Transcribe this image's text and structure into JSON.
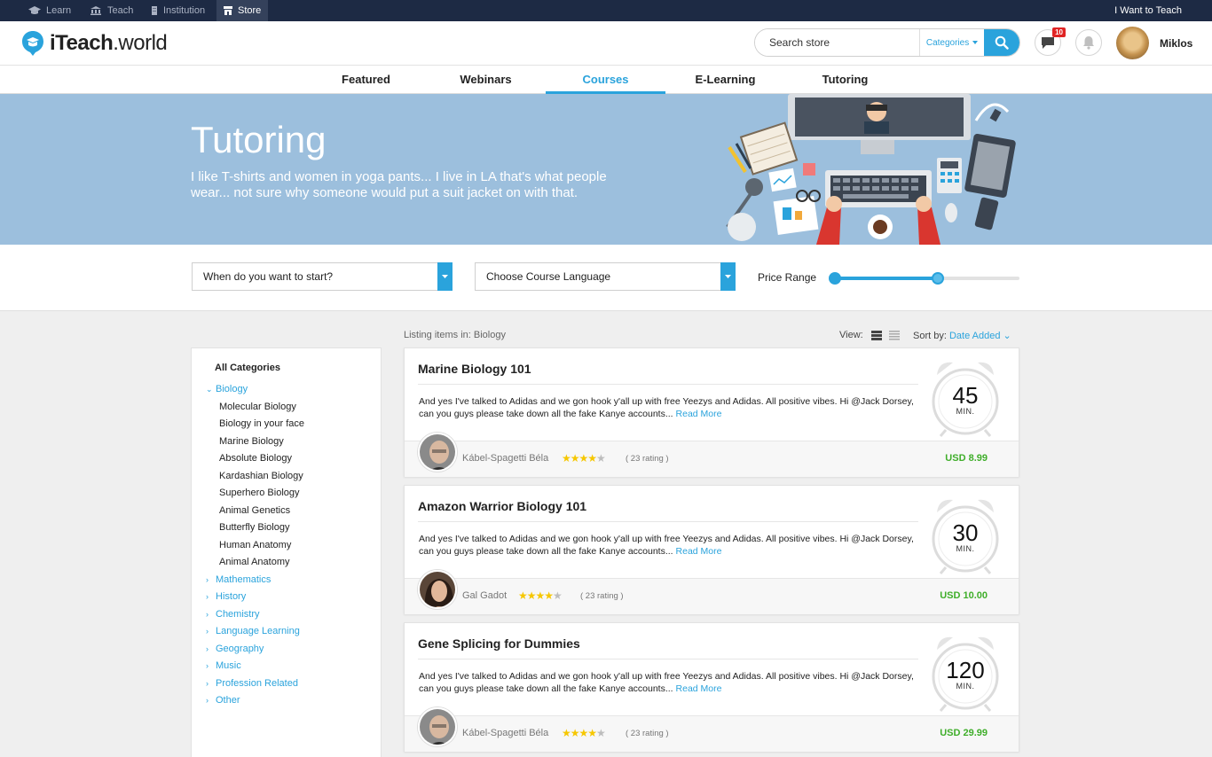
{
  "topbar": {
    "items": [
      {
        "label": "Learn",
        "icon": "graduation-cap-icon"
      },
      {
        "label": "Teach",
        "icon": "institution-icon"
      },
      {
        "label": "Institution",
        "icon": "building-icon"
      },
      {
        "label": "Store",
        "icon": "store-icon"
      }
    ],
    "active": "Store",
    "right_link": "I Want to Teach"
  },
  "header": {
    "logo_text_bold": "iTeach",
    "logo_text_rest": ".world",
    "search_placeholder": "Search store",
    "categories_label": "Categories",
    "messages_badge": "10",
    "user_name": "Miklos"
  },
  "nav": {
    "tabs": [
      "Featured",
      "Webinars",
      "Courses",
      "E-Learning",
      "Tutoring"
    ],
    "active": "Courses"
  },
  "hero": {
    "title": "Tutoring",
    "subtitle": "I like T-shirts and women in yoga pants... I live in LA that's what people wear... not sure why someone would put a suit jacket on with that."
  },
  "filters": {
    "start_placeholder": "When do you want to start?",
    "language_placeholder": "Choose Course Language",
    "price_label": "Price Range",
    "price_range_fraction": [
      0.0,
      0.56
    ]
  },
  "sidebar": {
    "title": "All Categories",
    "expanded": {
      "label": "Biology",
      "children": [
        "Molecular Biology",
        "Biology in your face",
        "Marine Biology",
        "Absolute Biology",
        "Kardashian Biology",
        "Superhero Biology",
        "Animal Genetics",
        "Butterfly Biology",
        "Human Anatomy",
        "Animal Anatomy"
      ]
    },
    "categories": [
      "Mathematics",
      "History",
      "Chemistry",
      "Language Learning",
      "Geography",
      "Music",
      "Profession Related",
      "Other"
    ]
  },
  "listing": {
    "label": "Listing items in: Biology",
    "view_label": "View:",
    "sort_label": "Sort by:",
    "sort_value": "Date Added"
  },
  "courses": [
    {
      "title": "Marine Biology 101",
      "description": "And yes I've talked to Adidas and we gon hook y'all up with free Yeezys and Adidas. All positive vibes. Hi @Jack Dorsey, can you guys please take down all the fake Kanye accounts...",
      "read_more": "Read More",
      "tutor": "Kábel-Spagetti Béla",
      "stars": 4,
      "rating": "( 23 rating )",
      "price": "USD 8.99",
      "duration": "45",
      "unit": "MIN."
    },
    {
      "title": "Amazon Warrior Biology 101",
      "description": "And yes I've talked to Adidas and we gon hook y'all up with free Yeezys and Adidas. All positive vibes. Hi @Jack Dorsey, can you guys please take down all the fake Kanye accounts...",
      "read_more": "Read More",
      "tutor": "Gal Gadot",
      "stars": 4,
      "rating": "( 23 rating )",
      "price": "USD 10.00",
      "duration": "30",
      "unit": "MIN."
    },
    {
      "title": "Gene Splicing for Dummies",
      "description": "And yes I've talked to Adidas and we gon hook y'all up with free Yeezys and Adidas. All positive vibes. Hi @Jack Dorsey, can you guys please take down all the fake Kanye accounts...",
      "read_more": "Read More",
      "tutor": "Kábel-Spagetti Béla",
      "stars": 4,
      "rating": "( 23 rating )",
      "price": "USD 29.99",
      "duration": "120",
      "unit": "MIN."
    }
  ],
  "colors": {
    "accent": "#2aa3dc",
    "topbar": "#1d2a44",
    "hero": "#9cbfdd",
    "price": "#3fae2a",
    "star": "#f6c700"
  }
}
